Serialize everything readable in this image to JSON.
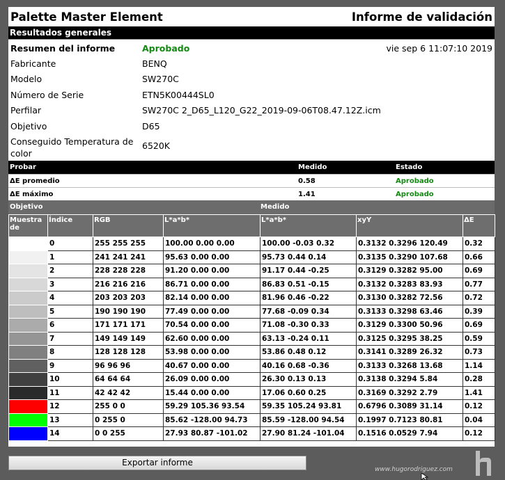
{
  "header": {
    "app_title": "Palette Master Element",
    "report_title": "Informe de validación"
  },
  "summary_section": "Resultados generales",
  "summary": {
    "label": "Resumen del informe",
    "result": "Aprobado",
    "datetime": "vie sep 6 11:07:10 2019",
    "rows": [
      {
        "key": "Fabricante",
        "value": "BENQ"
      },
      {
        "key": "Modelo",
        "value": "SW270C"
      },
      {
        "key": "Número de Serie",
        "value": "ETN5K00444SL0"
      },
      {
        "key": "Perfilar",
        "value": "SW270C 2_D65_L120_G22_2019-09-06T08.47.12Z.icm"
      },
      {
        "key": "Objetivo",
        "value": "D65"
      }
    ],
    "temp_key_line1": "Conseguido Temperatura de",
    "temp_key_line2": "color",
    "temp_value": "6520K"
  },
  "probar": {
    "headers": [
      "Probar",
      "Medido",
      "Estado"
    ],
    "rows": [
      {
        "label": "ΔE promedio",
        "value": "0.58",
        "status": "Aprobado"
      },
      {
        "label": "ΔE máximo",
        "value": "1.41",
        "status": "Aprobado"
      }
    ]
  },
  "group_headers": {
    "target": "Objetivo",
    "measured": "Medido"
  },
  "table": {
    "columns": [
      "Muestra de",
      "Índice",
      "RGB",
      "L*a*b*",
      "L*a*b*",
      "xyY",
      "ΔE"
    ],
    "rows": [
      {
        "swatch": "#ffffff",
        "index": "0",
        "rgb": "255  255  255",
        "lab_t": "100.00  0.00  0.00",
        "lab_m": "100.00  -0.03  0.32",
        "xyy": "0.3132  0.3296  120.49",
        "de": "0.32"
      },
      {
        "swatch": "#f1f1f1",
        "index": "1",
        "rgb": "241  241  241",
        "lab_t": "95.63  0.00  0.00",
        "lab_m": "95.73  0.44  0.14",
        "xyy": "0.3135  0.3290  107.68",
        "de": "0.66"
      },
      {
        "swatch": "#e4e4e4",
        "index": "2",
        "rgb": "228  228  228",
        "lab_t": "91.20  0.00  0.00",
        "lab_m": "91.17  0.44  -0.25",
        "xyy": "0.3129  0.3282  95.00",
        "de": "0.69"
      },
      {
        "swatch": "#d8d8d8",
        "index": "3",
        "rgb": "216  216  216",
        "lab_t": "86.71  0.00  0.00",
        "lab_m": "86.83  0.51  -0.15",
        "xyy": "0.3132  0.3283  83.93",
        "de": "0.77"
      },
      {
        "swatch": "#cbcbcb",
        "index": "4",
        "rgb": "203  203  203",
        "lab_t": "82.14  0.00  0.00",
        "lab_m": "81.96  0.46  -0.22",
        "xyy": "0.3130  0.3282  72.56",
        "de": "0.72"
      },
      {
        "swatch": "#bebebe",
        "index": "5",
        "rgb": "190  190  190",
        "lab_t": "77.49  0.00  0.00",
        "lab_m": "77.68  -0.09  0.34",
        "xyy": "0.3133  0.3298  63.46",
        "de": "0.39"
      },
      {
        "swatch": "#ababab",
        "index": "6",
        "rgb": "171  171  171",
        "lab_t": "70.54  0.00  0.00",
        "lab_m": "71.08  -0.30  0.33",
        "xyy": "0.3129  0.3300  50.96",
        "de": "0.69"
      },
      {
        "swatch": "#959595",
        "index": "7",
        "rgb": "149  149  149",
        "lab_t": "62.60  0.00  0.00",
        "lab_m": "63.13  -0.24  0.11",
        "xyy": "0.3125  0.3295  38.25",
        "de": "0.59"
      },
      {
        "swatch": "#808080",
        "index": "8",
        "rgb": "128  128  128",
        "lab_t": "53.98  0.00  0.00",
        "lab_m": "53.86  0.48  0.12",
        "xyy": "0.3141  0.3289  26.32",
        "de": "0.73"
      },
      {
        "swatch": "#606060",
        "index": "9",
        "rgb": "96  96  96",
        "lab_t": "40.67  0.00  0.00",
        "lab_m": "40.16  0.68  -0.36",
        "xyy": "0.3133  0.3268  13.68",
        "de": "1.14"
      },
      {
        "swatch": "#404040",
        "index": "10",
        "rgb": "64  64  64",
        "lab_t": "26.09  0.00  0.00",
        "lab_m": "26.30  0.13  0.13",
        "xyy": "0.3138  0.3294  5.84",
        "de": "0.28"
      },
      {
        "swatch": "#2a2a2a",
        "index": "11",
        "rgb": "42  42  42",
        "lab_t": "15.44  0.00  0.00",
        "lab_m": "17.06  0.60  0.25",
        "xyy": "0.3169  0.3292  2.79",
        "de": "1.41"
      },
      {
        "swatch": "#ff0000",
        "index": "12",
        "rgb": "255  0  0",
        "lab_t": "59.29  105.36  93.54",
        "lab_m": "59.35  105.24  93.81",
        "xyy": "0.6796  0.3089  31.14",
        "de": "0.12"
      },
      {
        "swatch": "#00ff00",
        "index": "13",
        "rgb": "0  255  0",
        "lab_t": "85.62  -128.00  94.73",
        "lab_m": "85.59  -128.00  94.54",
        "xyy": "0.1997  0.7123  80.81",
        "de": "0.04"
      },
      {
        "swatch": "#0000ff",
        "index": "14",
        "rgb": "0  0  255",
        "lab_t": "27.93  80.87  -101.02",
        "lab_m": "27.90  81.24  -101.04",
        "xyy": "0.1516  0.0529  7.94",
        "de": "0.12"
      }
    ]
  },
  "export_label": "Exportar informe",
  "watermark": "www.hugorodriguez.com",
  "colors": {
    "pass_green": "#138a13",
    "window_bg": "#5c5c5c",
    "header_bar": "#000000",
    "table_header": "#6e6e6e"
  },
  "icons": {
    "brand_logo": "h-logo-icon",
    "cursor": "mouse-pointer-icon"
  }
}
